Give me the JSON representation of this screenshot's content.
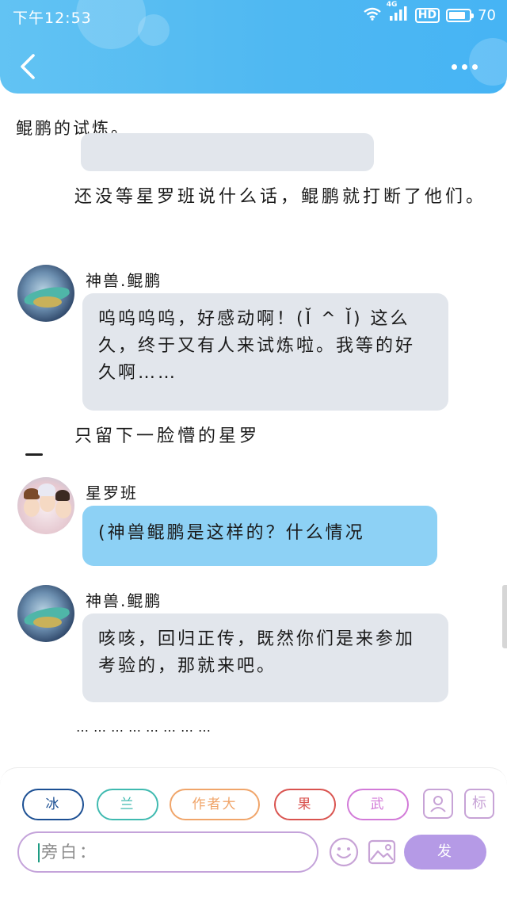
{
  "status_bar": {
    "time": "下午12:53",
    "network_label": "4G",
    "hd_label": "HD",
    "battery": "70"
  },
  "content": {
    "chapter_title": "鲲鹏的试炼。",
    "narration_1": "还没等星罗班说什么话，鲲鹏就打断了他们。",
    "narration_2": "只留下一脸懵的星罗",
    "ellipsis": "……………………",
    "messages": [
      {
        "sender": "神兽.鲲鹏",
        "text": "呜呜呜呜，好感动啊！(Ĭ ^ Ĭ) 这么久，终于又有人来试炼啦。我等的好久啊……"
      },
      {
        "sender": "星罗班",
        "text": "(神兽鲲鹏是这样的？什么情况"
      },
      {
        "sender": "神兽.鲲鹏",
        "text": "咳咳，回归正传，既然你们是来参加考验的，那就来吧。"
      }
    ]
  },
  "bottom_bar": {
    "characters": [
      {
        "label": "冰",
        "color": "#1b4f93"
      },
      {
        "label": "兰",
        "color": "#3fbab0"
      },
      {
        "label": "作者大",
        "color": "#f0a56a"
      },
      {
        "label": "果",
        "color": "#d9534f"
      },
      {
        "label": "武",
        "color": "#d27ad8"
      }
    ],
    "square_button_label": "标",
    "input_placeholder": "旁白：",
    "send_label": "发"
  },
  "colors": {
    "header": "#4fb8f2",
    "bubble_grey": "#e2e6ec",
    "bubble_blue": "#8dd1f5",
    "send": "#b59ae6",
    "accent_purple": "#c4a3da"
  }
}
